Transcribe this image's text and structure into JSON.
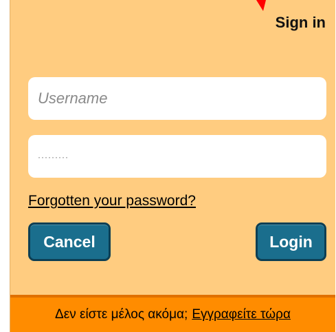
{
  "dialog": {
    "title": "Sign in"
  },
  "username": {
    "placeholder": "Username",
    "value": ""
  },
  "password": {
    "masked_value": "·········"
  },
  "forgot_link": "Forgotten your password?",
  "buttons": {
    "cancel": "Cancel",
    "login": "Login"
  },
  "footer": {
    "prompt": "Δεν είστε μέλος ακόμα;",
    "signup_link": "Εγγραφείτε τώρα"
  },
  "colors": {
    "panel_background": "#ffcc80",
    "button_fill": "#1a6e8d",
    "button_border": "#0d3f54",
    "footer_background": "#ff8c00",
    "arrow": "#ff0000"
  },
  "icons": {
    "arrow": "red-pointer-arrow-icon"
  }
}
